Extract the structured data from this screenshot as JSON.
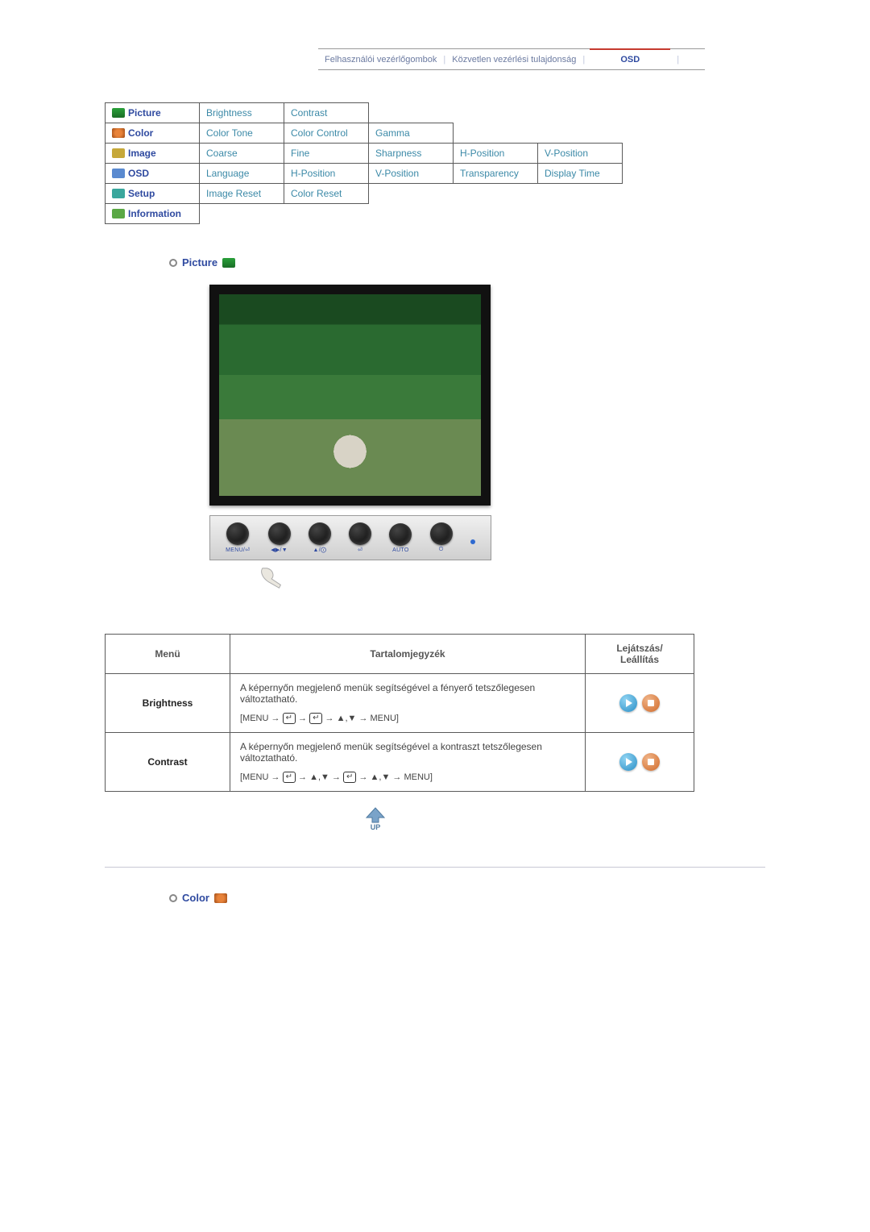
{
  "topbar": {
    "tabs": [
      "Felhasználói vezérlőgombok",
      "Közvetlen vezérlési tulajdonság"
    ],
    "active": "OSD"
  },
  "menu": {
    "rows": [
      {
        "cat": "Picture",
        "icon": "pic",
        "subs": [
          "Brightness",
          "Contrast",
          "",
          "",
          ""
        ]
      },
      {
        "cat": "Color",
        "icon": "col",
        "subs": [
          "Color Tone",
          "Color Control",
          "Gamma",
          "",
          ""
        ]
      },
      {
        "cat": "Image",
        "icon": "img",
        "subs": [
          "Coarse",
          "Fine",
          "Sharpness",
          "H-Position",
          "V-Position"
        ]
      },
      {
        "cat": "OSD",
        "icon": "osd",
        "subs": [
          "Language",
          "H-Position",
          "V-Position",
          "Transparency",
          "Display Time"
        ]
      },
      {
        "cat": "Setup",
        "icon": "set",
        "subs": [
          "Image Reset",
          "Color Reset",
          "",
          "",
          ""
        ]
      },
      {
        "cat": "Information",
        "icon": "info",
        "subs": []
      }
    ]
  },
  "section_picture_title": "Picture",
  "section_color_title": "Color",
  "button_labels": [
    "MENU/⏎",
    "◀▶/▼",
    "▲/⨀",
    "⏎",
    "AUTO",
    "⏻"
  ],
  "content_table": {
    "head": {
      "menu": "Menü",
      "desc": "Tartalomjegyzék",
      "ctrl": "Lejátszás/\nLeállítás"
    },
    "rows": [
      {
        "name": "Brightness",
        "desc": "A képernyőn megjelenő menük segítségével a fényerő tetszőlegesen változtatható.",
        "seq": "[MENU → ⏎ → ⏎ → ▲,▼ → MENU]"
      },
      {
        "name": "Contrast",
        "desc": "A képernyőn megjelenő menük segítségével a kontraszt tetszőlegesen változtatható.",
        "seq": "[MENU → ⏎ → ▲,▼ → ⏎ → ▲,▼ → MENU]"
      }
    ]
  },
  "up_label": "UP"
}
